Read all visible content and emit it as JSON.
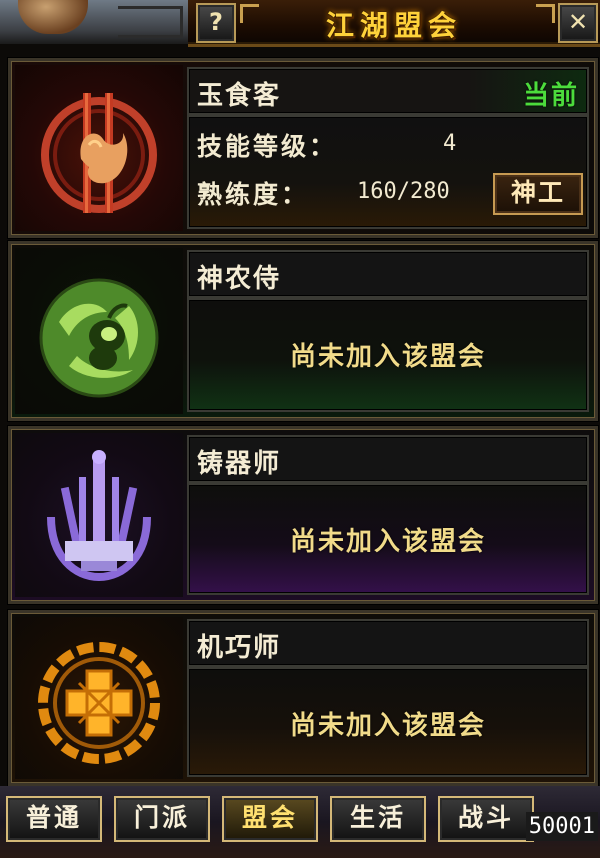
{
  "window": {
    "title": "江湖盟会",
    "help_label": "?",
    "close_label": "✕"
  },
  "guilds": [
    {
      "name": "玉食客",
      "current_tag": "当前",
      "skill_level_label": "技能等级：",
      "skill_level_value": "4",
      "proficiency_label": "熟练度：",
      "proficiency_value": "160/280",
      "action_label": "神工",
      "emblem": "chef-emblem-icon",
      "accent": "#c43a1c"
    },
    {
      "name": "神农侍",
      "status": "尚未加入该盟会",
      "emblem": "gourd-emblem-icon",
      "accent": "#7ac040"
    },
    {
      "name": "铸器师",
      "status": "尚未加入该盟会",
      "emblem": "weapon-rack-emblem-icon",
      "accent": "#9a78e8"
    },
    {
      "name": "机巧师",
      "status": "尚未加入该盟会",
      "emblem": "gear-emblem-icon",
      "accent": "#f0a020"
    }
  ],
  "tabs": [
    {
      "label": "普通",
      "active": false
    },
    {
      "label": "门派",
      "active": false
    },
    {
      "label": "盟会",
      "active": true
    },
    {
      "label": "生活",
      "active": false
    },
    {
      "label": "战斗",
      "active": false
    }
  ],
  "bottom_value": "50001"
}
